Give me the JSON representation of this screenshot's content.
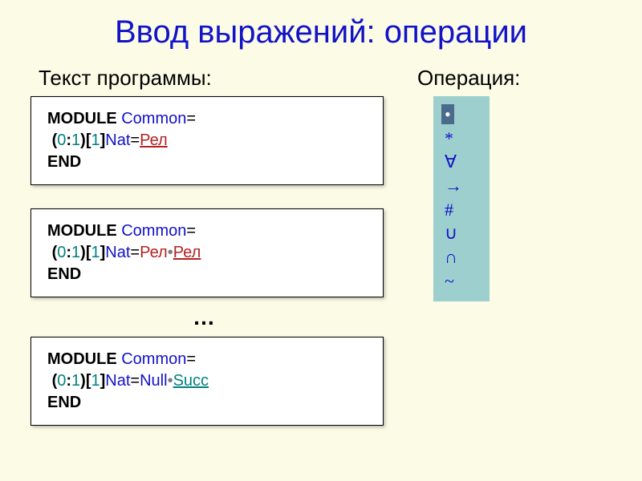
{
  "title": "Ввод выражений: операции",
  "labels": {
    "left": "Текст программы:",
    "right": "Операция:"
  },
  "code": {
    "module_kw": "MODULE",
    "end_kw": "END",
    "common": " Common",
    "eq": "=",
    "open_paren": "(",
    "zero": "0",
    "colon": ":",
    "one_paren": "1",
    "close_paren": ")",
    "open_brack": "[",
    "one_brack": "1",
    "close_brack": "]",
    "nat": "Nat",
    "rel": "Рел",
    "bullet": "•",
    "null_word": "Null",
    "succ": "Succ"
  },
  "ellipsis": "…",
  "ops": {
    "items": [
      "•",
      "*",
      "∀",
      "→",
      "#",
      "∪",
      "∩",
      "~"
    ],
    "selected_index": 0
  }
}
